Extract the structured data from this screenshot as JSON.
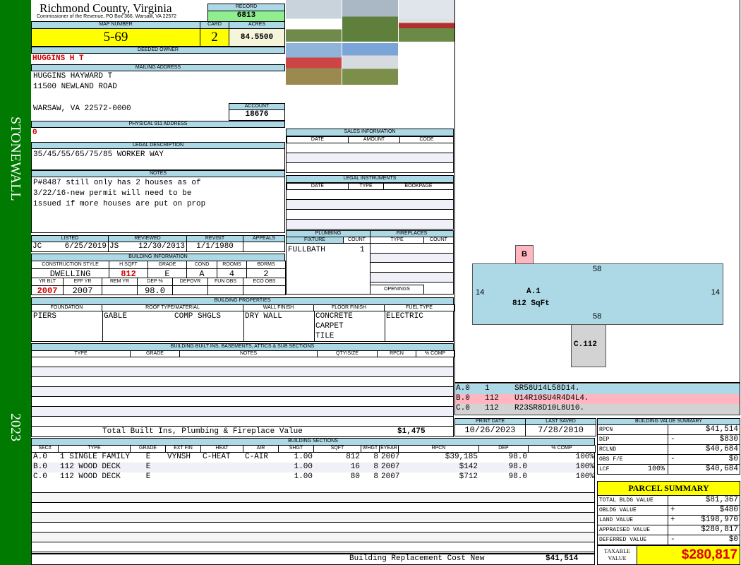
{
  "side": {
    "district": "STONEWALL",
    "year": "2023"
  },
  "header": {
    "county": "Richmond County, Virginia",
    "subtitle": "Commissioner of the Revenue, PO Box 366, Warsaw, VA 22572",
    "record_label": "RECORD",
    "record": "6813"
  },
  "parcel": {
    "map_label": "MAP NUMBER",
    "map": "5-69",
    "card_label": "CARD",
    "card": "2",
    "acres_label": "ACRES",
    "acres": "84.5500"
  },
  "owner": {
    "label": "DEEDED OWNER",
    "name": "HUGGINS H T"
  },
  "mailing": {
    "label": "MAILING ADDRESS",
    "line1": "HUGGINS HAYWARD T",
    "line2": "11500 NEWLAND ROAD",
    "line3": "WARSAW, VA 22572-0000",
    "account_label": "ACCOUNT",
    "account": "18676"
  },
  "physical": {
    "label": "PHYSICAL 911 ADDRESS",
    "value": "0"
  },
  "legal": {
    "label": "LEGAL DESCRIPTION",
    "value": "35/45/55/65/75/85 WORKER WAY"
  },
  "notes": {
    "label": "NOTES",
    "lines": [
      "P#8487 still only has 2 houses as of",
      "3/22/16-new permit will need to be",
      "issued if more houses are put on prop"
    ]
  },
  "dates": {
    "listed_label": "LISTED",
    "listed_by": "JC",
    "listed": "6/25/2019",
    "reviewed_label": "REVIEWED",
    "reviewed_by": "JS",
    "reviewed": "12/30/2013",
    "revisit_label": "REVISIT",
    "revisit": "1/1/1980",
    "appeals_label": "APPEALS",
    "appeals": ""
  },
  "building_info": {
    "label": "BUILDING INFORMATION",
    "headers1": [
      "CONSTRUCTION STYLE",
      "H SQFT",
      "GRADE",
      "COND",
      "ROOMS",
      "BDRMS"
    ],
    "values1": [
      "DWELLING",
      "812",
      "E",
      "A",
      "4",
      "2"
    ],
    "headers2": [
      "YR BLT",
      "EFF YR",
      "REM YR",
      "DEP %",
      "DEPOVR",
      "FUN OBS",
      "ECO OBS"
    ],
    "values2": [
      "2007",
      "2007",
      "",
      "98.0",
      "",
      "",
      ""
    ]
  },
  "sales": {
    "label": "SALES INFORMATION",
    "headers": [
      "DATE",
      "AMOUNT",
      "CODE"
    ]
  },
  "legal_instruments": {
    "label": "LEGAL INSTRUMENTS",
    "headers": [
      "DATE",
      "TYPE",
      "BOOKPAGE"
    ]
  },
  "plumbing": {
    "label": "PLUMBING",
    "headers": [
      "FIXTURE",
      "COUNT"
    ],
    "rows": [
      [
        "FULLBATH",
        "1"
      ]
    ]
  },
  "fireplaces": {
    "label": "FIREPLACES",
    "headers": [
      "TYPE",
      "COUNT"
    ],
    "openings_label": "OPENINGS"
  },
  "properties": {
    "label": "BUILDING PROPERTIES",
    "headers": [
      "FOUNDATION",
      "ROOF TYPE/MATERIAL",
      "WALL FINISH",
      "FLOOR FINISH",
      "FUEL TYPE"
    ],
    "foundation": "PIERS",
    "roof_type": "GABLE",
    "roof_material": "COMP SHGLS",
    "wall": "DRY WALL",
    "floor": [
      "CONCRETE",
      "CARPET",
      "TILE"
    ],
    "fuel": "ELECTRIC"
  },
  "builtins": {
    "label": "BUILDING BUILT INS, BASEMENTS, ATTICS & SUB SECTIONS",
    "headers": [
      "TYPE",
      "GRADE",
      "NOTES",
      "QTY/SIZE",
      "RPCN",
      "% COMP"
    ],
    "total_label": "Total Built Ins, Plumbing & Fireplace Value",
    "total": "$1,475"
  },
  "sections": {
    "label": "BUILDING SECTIONS",
    "headers": [
      "SEC#",
      "TYPE",
      "GRADE",
      "EXT FIN",
      "HEAT",
      "AIR",
      "SHGT",
      "SQFT",
      "WHGT",
      "EYEAR",
      "RPCN",
      "DEP",
      "% COMP"
    ],
    "rows": [
      [
        "A.0",
        "1 SINGLE FAMILY",
        "E",
        "VYNSH",
        "C-HEAT",
        "C-AIR",
        "1.00",
        "812",
        "8",
        "2007",
        "$39,185",
        "98.0",
        "100%"
      ],
      [
        "B.0",
        "112 WOOD DECK",
        "E",
        "",
        "",
        "",
        "1.00",
        "16",
        "8",
        "2007",
        "$142",
        "98.0",
        "100%"
      ],
      [
        "C.0",
        "112 WOOD DECK",
        "E",
        "",
        "",
        "",
        "1.00",
        "80",
        "8",
        "2007",
        "$712",
        "98.0",
        "100%"
      ]
    ],
    "replacement_label": "Building Replacement Cost New",
    "replacement": "$41,514"
  },
  "sketch": {
    "main_label": "A.1",
    "main_area": "812 SqFt",
    "top": "58",
    "bottom": "58",
    "left": "14",
    "right": "14",
    "b_label": "B",
    "c_label": "C.112",
    "codes": [
      [
        "A.0",
        "1",
        "SR58U14L58D14."
      ],
      [
        "B.0",
        "112",
        "U14R10SU4R4D4L4."
      ],
      [
        "C.0",
        "112",
        "R23SR8D10L8U10."
      ]
    ],
    "colors": {
      "a": "#add8e6",
      "b": "#ffb6c1",
      "c": "#d3d3d3"
    }
  },
  "print": {
    "print_label": "PRINT DATE",
    "print": "10/26/2023",
    "saved_label": "LAST SAVED",
    "saved": "7/28/2010"
  },
  "bvs": {
    "label": "BUILDING VALUE SUMMARY",
    "rows": [
      [
        "RPCN",
        "",
        "$41,514"
      ],
      [
        "DEP",
        "-",
        "$830"
      ],
      [
        "RCLND",
        "",
        "$40,684"
      ],
      [
        "OBS F/E",
        "-",
        "$0"
      ],
      [
        "LCF",
        "100%",
        "$40,684"
      ]
    ]
  },
  "summary": {
    "label": "PARCEL SUMMARY",
    "rows": [
      [
        "TOTAL BLDG VALUE",
        "",
        "$81,367"
      ],
      [
        "OBLDG VALUE",
        "+",
        "$480"
      ],
      [
        "LAND VALUE",
        "+",
        "$198,970"
      ],
      [
        "APPRAISED VALUE",
        "",
        "$280,817"
      ],
      [
        "DEFERRED VALUE",
        "-",
        "$0"
      ]
    ],
    "taxable_label": "TAXABLE VALUE",
    "taxable": "$280,817"
  }
}
